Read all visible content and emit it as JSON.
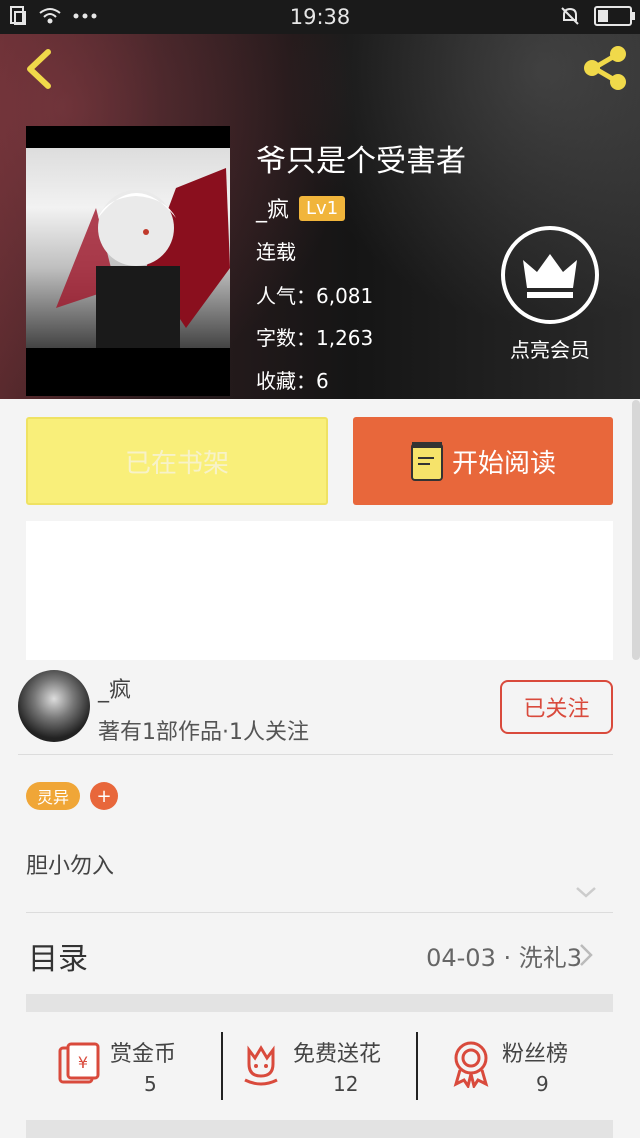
{
  "status_bar": {
    "time": "19:38"
  },
  "header": {
    "back_icon": "chevron-left-icon",
    "share_icon": "share-icon"
  },
  "book": {
    "title": "爷只是个受害者",
    "author": "_疯",
    "level": "Lv1",
    "status": "连载",
    "popularity": "人气：6,081",
    "word_count": "字数：1,263",
    "favorites": "收藏：6"
  },
  "vip": {
    "label": "点亮会员",
    "icon": "crown-icon"
  },
  "actions": {
    "shelf_label": "已在书架",
    "read_label": "开始阅读"
  },
  "author_card": {
    "name": "_疯",
    "subtitle": "著有1部作品·1人关注",
    "follow_label": "已关注"
  },
  "tags": {
    "genre": "灵异",
    "add": "+"
  },
  "description": "胆小勿入",
  "toc": {
    "label": "目录",
    "latest": "04-03 · 洗礼3"
  },
  "stats": [
    {
      "label": "赏金币",
      "value": "5",
      "icon": "red-envelope-icon"
    },
    {
      "label": "免费送花",
      "value": "12",
      "icon": "flower-icon"
    },
    {
      "label": "粉丝榜",
      "value": "9",
      "icon": "medal-icon"
    }
  ],
  "colors": {
    "accent": "#e8673b",
    "shelf": "#f9ef7a",
    "follow": "#d94a3c",
    "tag": "#f0a637"
  }
}
